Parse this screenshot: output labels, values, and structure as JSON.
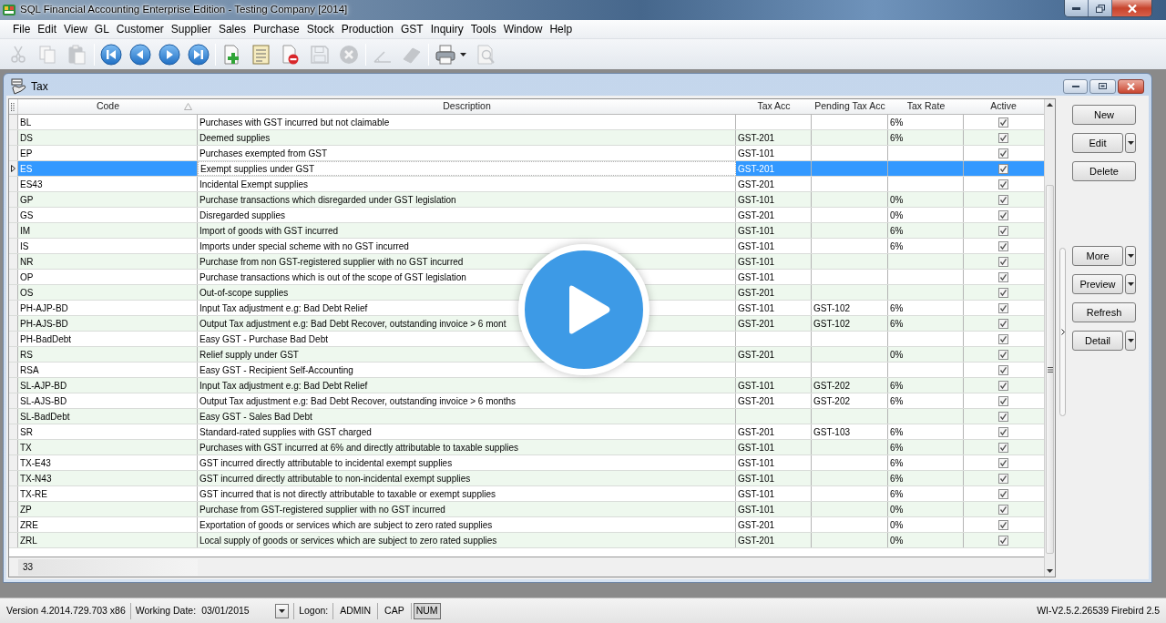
{
  "window": {
    "title": "SQL Financial Accounting Enterprise Edition - Testing Company [2014]"
  },
  "menu": [
    "File",
    "Edit",
    "View",
    "GL",
    "Customer",
    "Supplier",
    "Sales",
    "Purchase",
    "Stock",
    "Production",
    "GST",
    "Inquiry",
    "Tools",
    "Window",
    "Help"
  ],
  "toolbar": [
    {
      "kind": "cut",
      "disabled": true
    },
    {
      "kind": "copy",
      "disabled": true
    },
    {
      "kind": "paste",
      "disabled": true
    },
    {
      "kind": "separator"
    },
    {
      "kind": "first",
      "disabled": false
    },
    {
      "kind": "previous",
      "disabled": false
    },
    {
      "kind": "next",
      "disabled": false
    },
    {
      "kind": "last",
      "disabled": false
    },
    {
      "kind": "separator"
    },
    {
      "kind": "new",
      "disabled": false
    },
    {
      "kind": "edit",
      "disabled": false
    },
    {
      "kind": "delete",
      "disabled": false
    },
    {
      "kind": "save",
      "disabled": true
    },
    {
      "kind": "cancel",
      "disabled": true
    },
    {
      "kind": "separator"
    },
    {
      "kind": "angle",
      "disabled": true
    },
    {
      "kind": "eraser",
      "disabled": true
    },
    {
      "kind": "separator"
    },
    {
      "kind": "print",
      "disabled": false,
      "dropdown": true
    },
    {
      "kind": "preview",
      "disabled": true
    }
  ],
  "child_window": {
    "title": "Tax"
  },
  "table": {
    "columns": [
      {
        "label": "Code",
        "sorted": true,
        "focused": false
      },
      {
        "label": "Description",
        "sorted": false,
        "focused": true
      },
      {
        "label": "Tax Acc",
        "sorted": false,
        "focused": false
      },
      {
        "label": "Pending Tax Acc",
        "sorted": false,
        "focused": false
      },
      {
        "label": "Tax Rate",
        "sorted": false,
        "focused": false
      },
      {
        "label": "Active",
        "sorted": false,
        "focused": false
      }
    ],
    "rows": [
      {
        "code": "BL",
        "description": "Purchases with GST incurred but not claimable",
        "tax_rate": "6%",
        "active": true,
        "selected": false
      },
      {
        "code": "DS",
        "description": "Deemed supplies",
        "tax_acc": "GST-201",
        "tax_rate": "6%",
        "active": true,
        "selected": false
      },
      {
        "code": "EP",
        "description": "Purchases exempted from GST",
        "tax_acc": "GST-101",
        "active": true,
        "selected": false
      },
      {
        "code": "ES",
        "description": "Exempt supplies under GST",
        "tax_acc": "GST-201",
        "active": true,
        "selected": true
      },
      {
        "code": "ES43",
        "description": "Incidental Exempt supplies",
        "tax_acc": "GST-201",
        "active": true,
        "selected": false
      },
      {
        "code": "GP",
        "description": "Purchase transactions which disregarded under GST legislation",
        "tax_acc": "GST-101",
        "tax_rate": "0%",
        "active": true,
        "selected": false
      },
      {
        "code": "GS",
        "description": "Disregarded supplies",
        "tax_acc": "GST-201",
        "tax_rate": "0%",
        "active": true,
        "selected": false
      },
      {
        "code": "IM",
        "description": "Import of goods with GST incurred",
        "tax_acc": "GST-101",
        "tax_rate": "6%",
        "active": true,
        "selected": false
      },
      {
        "code": "IS",
        "description": "Imports under special scheme with no GST incurred",
        "tax_acc": "GST-101",
        "tax_rate": "6%",
        "active": true,
        "selected": false
      },
      {
        "code": "NR",
        "description": "Purchase from non GST-registered supplier with no GST incurred",
        "tax_acc": "GST-101",
        "active": true,
        "selected": false
      },
      {
        "code": "OP",
        "description": "Purchase transactions which is out of the scope of GST legislation",
        "tax_acc": "GST-101",
        "active": true,
        "selected": false
      },
      {
        "code": "OS",
        "description": "Out-of-scope supplies",
        "tax_acc": "GST-201",
        "active": true,
        "selected": false
      },
      {
        "code": "PH-AJP-BD",
        "description": "Input Tax adjustment e.g: Bad Debt Relief",
        "tax_acc": "GST-101",
        "pending_tax_acc": "GST-102",
        "tax_rate": "6%",
        "active": true,
        "selected": false
      },
      {
        "code": "PH-AJS-BD",
        "description": "Output Tax adjustment e.g: Bad Debt Recover, outstanding invoice > 6 mont",
        "tax_acc": "GST-201",
        "pending_tax_acc": "GST-102",
        "tax_rate": "6%",
        "active": true,
        "selected": false
      },
      {
        "code": "PH-BadDebt",
        "description": "Easy GST - Purchase Bad Debt",
        "active": true,
        "selected": false
      },
      {
        "code": "RS",
        "description": "Relief supply under GST",
        "tax_acc": "GST-201",
        "tax_rate": "0%",
        "active": true,
        "selected": false
      },
      {
        "code": "RSA",
        "description": "Easy GST - Recipient Self-Accounting",
        "active": true,
        "selected": false
      },
      {
        "code": "SL-AJP-BD",
        "description": "Input Tax adjustment e.g: Bad Debt Relief",
        "tax_acc": "GST-101",
        "pending_tax_acc": "GST-202",
        "tax_rate": "6%",
        "active": true,
        "selected": false
      },
      {
        "code": "SL-AJS-BD",
        "description": "Output Tax adjustment e.g: Bad Debt Recover, outstanding invoice > 6 months",
        "tax_acc": "GST-201",
        "pending_tax_acc": "GST-202",
        "tax_rate": "6%",
        "active": true,
        "selected": false
      },
      {
        "code": "SL-BadDebt",
        "description": "Easy GST - Sales Bad Debt",
        "active": true,
        "selected": false
      },
      {
        "code": "SR",
        "description": "Standard-rated supplies with GST charged",
        "tax_acc": "GST-201",
        "pending_tax_acc": "GST-103",
        "tax_rate": "6%",
        "active": true,
        "selected": false
      },
      {
        "code": "TX",
        "description": "Purchases with GST incurred at 6% and directly attributable to taxable supplies",
        "tax_acc": "GST-101",
        "tax_rate": "6%",
        "active": true,
        "selected": false
      },
      {
        "code": "TX-E43",
        "description": "GST incurred directly attributable to incidental exempt supplies",
        "tax_acc": "GST-101",
        "tax_rate": "6%",
        "active": true,
        "selected": false
      },
      {
        "code": "TX-N43",
        "description": "GST incurred directly attributable to non-incidental exempt supplies",
        "tax_acc": "GST-101",
        "tax_rate": "6%",
        "active": true,
        "selected": false
      },
      {
        "code": "TX-RE",
        "description": "GST incurred that is not directly attributable to taxable or exempt supplies",
        "tax_acc": "GST-101",
        "tax_rate": "6%",
        "active": true,
        "selected": false
      },
      {
        "code": "ZP",
        "description": "Purchase from GST-registered supplier with no GST incurred",
        "tax_acc": "GST-101",
        "tax_rate": "0%",
        "active": true,
        "selected": false
      },
      {
        "code": "ZRE",
        "description": "Exportation of goods or services which are subject to zero rated supplies",
        "tax_acc": "GST-201",
        "tax_rate": "0%",
        "active": true,
        "selected": false
      },
      {
        "code": "ZRL",
        "description": "Local supply of goods or services which are subject to zero rated supplies",
        "tax_acc": "GST-201",
        "tax_rate": "0%",
        "active": true,
        "selected": false
      }
    ],
    "record_count": "33"
  },
  "button_groups": [
    [
      {
        "label": "New",
        "dropdown": false
      },
      {
        "label": "Edit",
        "dropdown": true
      },
      {
        "label": "Delete",
        "dropdown": false
      }
    ],
    [
      {
        "label": "More",
        "dropdown": true
      },
      {
        "label": "Preview",
        "dropdown": true
      },
      {
        "label": "Refresh",
        "dropdown": false
      },
      {
        "label": "Detail",
        "dropdown": true
      }
    ]
  ],
  "status_bar": {
    "version": "Version 4.2014.729.703 x86",
    "working_date_label": "Working Date:",
    "working_date": "03/01/2015",
    "logon_label": "Logon:",
    "user": "ADMIN",
    "indicators": [
      {
        "label": "CAP",
        "on": false
      },
      {
        "label": "NUM",
        "on": true
      }
    ],
    "server": "WI-V2.5.2.26539 Firebird 2.5"
  },
  "video_overlay": {
    "play_button": true
  }
}
